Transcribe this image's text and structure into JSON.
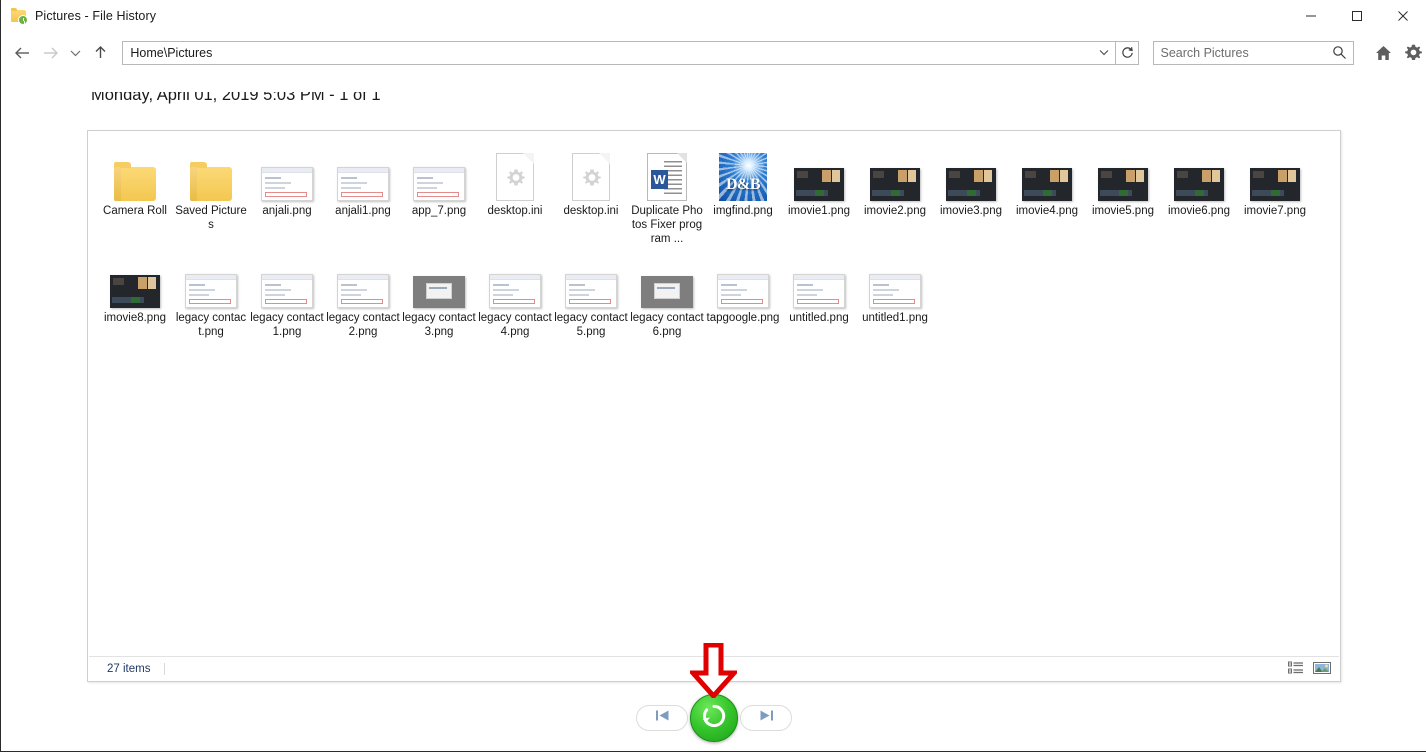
{
  "window": {
    "title": "Pictures - File History",
    "icon": "folder-history-icon",
    "minimize_label": "–",
    "maximize_label": "□",
    "close_label": "✕"
  },
  "addressbar": {
    "back_icon": "back-arrow-icon",
    "forward_icon": "forward-arrow-icon",
    "recent_icon": "chevron-down-icon",
    "up_icon": "up-arrow-icon",
    "path": "Home\\Pictures",
    "path_dropdown_icon": "chevron-down-icon",
    "refresh_icon": "refresh-icon"
  },
  "search": {
    "placeholder": "Search Pictures",
    "value": "",
    "icon": "search-icon"
  },
  "toolbar": {
    "home_icon": "home-icon",
    "settings_icon": "gear-icon"
  },
  "header": {
    "date_label": "Monday, April 01, 2019 5:03 PM - 1 of 1"
  },
  "files": [
    {
      "name": "Camera Roll",
      "kind": "folder"
    },
    {
      "name": "Saved Pictures",
      "kind": "folder"
    },
    {
      "name": "anjali.png",
      "kind": "image-light"
    },
    {
      "name": "anjali1.png",
      "kind": "image-light"
    },
    {
      "name": "app_7.png",
      "kind": "image-light"
    },
    {
      "name": "desktop.ini",
      "kind": "ini"
    },
    {
      "name": "desktop.ini",
      "kind": "ini"
    },
    {
      "name": "Duplicate Photos Fixer program ...",
      "kind": "word"
    },
    {
      "name": "imgfind.png",
      "kind": "db"
    },
    {
      "name": "imovie1.png",
      "kind": "image-dark"
    },
    {
      "name": "imovie2.png",
      "kind": "image-dark"
    },
    {
      "name": "imovie3.png",
      "kind": "image-dark"
    },
    {
      "name": "imovie4.png",
      "kind": "image-dark"
    },
    {
      "name": "imovie5.png",
      "kind": "image-dark"
    },
    {
      "name": "imovie6.png",
      "kind": "image-dark"
    },
    {
      "name": "imovie7.png",
      "kind": "image-dark"
    },
    {
      "name": "imovie8.png",
      "kind": "image-dark"
    },
    {
      "name": "legacy contact.png",
      "kind": "image-light"
    },
    {
      "name": "legacy contact1.png",
      "kind": "image-light"
    },
    {
      "name": "legacy contact2.png",
      "kind": "image-light"
    },
    {
      "name": "legacy contact3.png",
      "kind": "image-gray"
    },
    {
      "name": "legacy contact4.png",
      "kind": "image-light"
    },
    {
      "name": "legacy contact5.png",
      "kind": "image-light"
    },
    {
      "name": "legacy contact6.png",
      "kind": "image-gray"
    },
    {
      "name": "tapgoogle.png",
      "kind": "image-light"
    },
    {
      "name": "untitled.png",
      "kind": "image-light"
    },
    {
      "name": "untitled1.png",
      "kind": "image-light"
    }
  ],
  "statusbar": {
    "item_count": "27 items",
    "details_view_icon": "details-view-icon",
    "large_icons_view_icon": "large-icons-view-icon"
  },
  "player": {
    "previous_icon": "skip-previous-icon",
    "restore_icon": "restore-circular-arrow-icon",
    "next_icon": "skip-next-icon"
  },
  "annotation": {
    "arrow_icon": "red-down-arrow-marker",
    "arrow_color": "#e00000"
  },
  "colors": {
    "restore_green": "#2fbd24",
    "folder_yellow": "#f3c750",
    "word_blue": "#2b579a",
    "status_text": "#1f3864",
    "accent_blue": "#0c4ea0"
  }
}
